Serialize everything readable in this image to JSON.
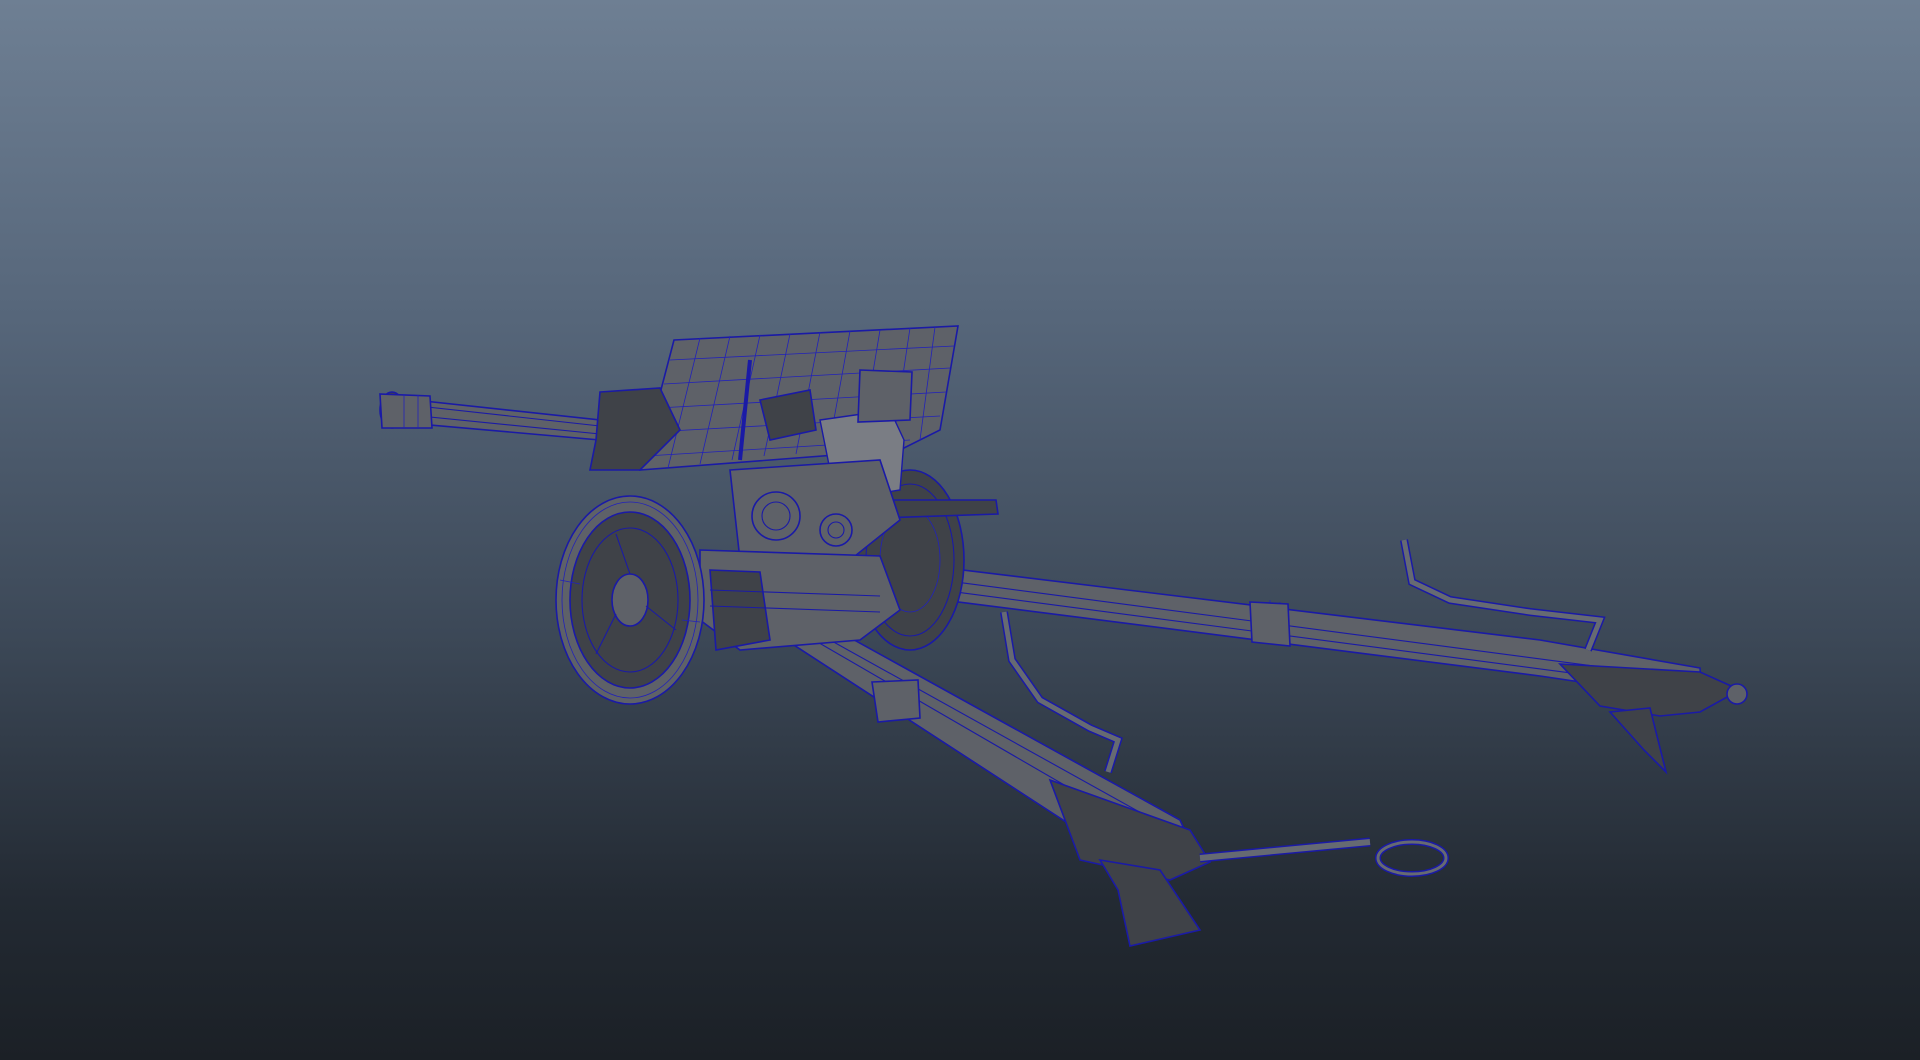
{
  "viewport": {
    "panel": "perspective-viewport",
    "background_top_color": "#6e7f93",
    "background_bottom_color": "#1b2026",
    "wireframe_color": "#1a1aa6",
    "shaded_color": "#5e6168",
    "display_mode": "wireframe-on-shaded"
  }
}
